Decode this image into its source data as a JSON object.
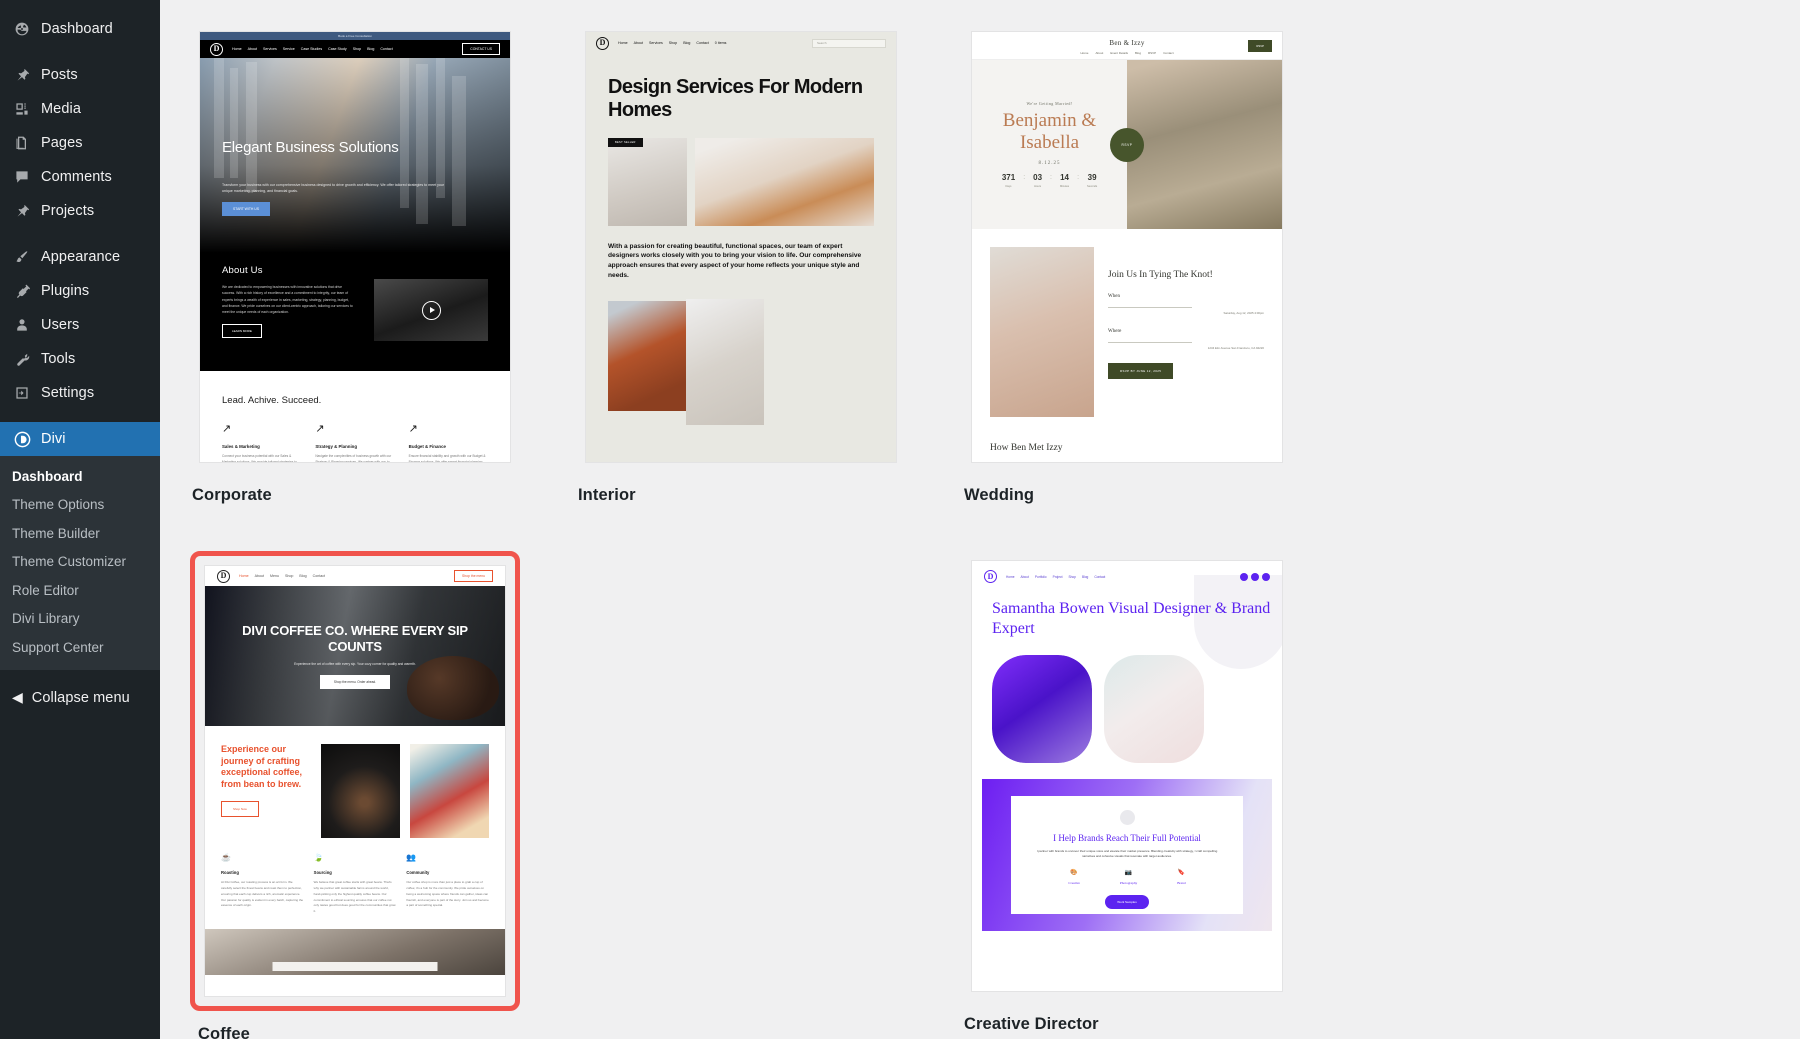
{
  "sidebar": {
    "items": [
      {
        "label": "Dashboard",
        "icon": "dashboard-icon"
      },
      {
        "label": "Posts",
        "icon": "pin-icon"
      },
      {
        "label": "Media",
        "icon": "media-icon"
      },
      {
        "label": "Pages",
        "icon": "pages-icon"
      },
      {
        "label": "Comments",
        "icon": "comment-icon"
      },
      {
        "label": "Projects",
        "icon": "pin-icon"
      },
      {
        "label": "Appearance",
        "icon": "brush-icon"
      },
      {
        "label": "Plugins",
        "icon": "plug-icon"
      },
      {
        "label": "Users",
        "icon": "user-icon"
      },
      {
        "label": "Tools",
        "icon": "wrench-icon"
      },
      {
        "label": "Settings",
        "icon": "settings-icon"
      }
    ],
    "divi": {
      "label": "Divi",
      "icon": "divi-logo-icon"
    },
    "submenu": [
      {
        "label": "Dashboard",
        "current": true
      },
      {
        "label": "Theme Options",
        "current": false
      },
      {
        "label": "Theme Builder",
        "current": false
      },
      {
        "label": "Theme Customizer",
        "current": false
      },
      {
        "label": "Role Editor",
        "current": false
      },
      {
        "label": "Divi Library",
        "current": false
      },
      {
        "label": "Support Center",
        "current": false
      }
    ],
    "collapse": {
      "label": "Collapse menu",
      "icon": "collapse-arrow-icon"
    }
  },
  "layouts": {
    "selected": "Coffee",
    "selection_color": "#f0544c",
    "cards": [
      {
        "name": "Corporate"
      },
      {
        "name": "Interior"
      },
      {
        "name": "Wedding"
      },
      {
        "name": "Coffee"
      },
      {
        "name": "Creative Director"
      }
    ]
  },
  "corporate": {
    "announcement": "Book a Free Consultation",
    "logo": "D",
    "nav": [
      "Home",
      "About",
      "Services",
      "Service",
      "Case Studies",
      "Case Study",
      "Shop",
      "Blog",
      "Contact"
    ],
    "cta": "CONTACT US",
    "hero_title": "Elegant Business Solutions",
    "hero_text": "Transform your business with our comprehensive business designed to drive growth and efficiency. We offer tailored strategies to meet your unique marketing, planning, and financial goals.",
    "hero_button": "START WITH US",
    "about_title": "About Us",
    "about_text": "We are dedicated to empowering businesses with innovative solutions that drive success. With a rich history of excellence and a commitment to integrity, our team of experts brings a wealth of experience in sales, marketing, strategy, planning, budget, and finance. We pride ourselves on our client-centric approach, tailoring our services to meet the unique needs of each organization.",
    "about_button": "LEARN MORE",
    "features_title": "Lead. Achive. Succeed.",
    "features": [
      {
        "title": "Sales & Marketing",
        "text": "Connect your business potential with our Sales & Marketing solutions. We provide tailored strategies to boost your brand visibility, drive customer engagement, and increase sales."
      },
      {
        "title": "Strategy & Planning",
        "text": "Navigate the complexities of business growth with our Strategy & Planning services. We partner with you to develop actionable plans that align with your long-term goals."
      },
      {
        "title": "Budget & Finance",
        "text": "Ensure financial stability and growth with our Budget & Finance solutions. We offer expert financial planning, budgeting, and analysis to help you manage resources efficiently."
      }
    ]
  },
  "interior": {
    "logo": "D",
    "nav": [
      "Home",
      "About",
      "Services",
      "Shop",
      "Blog",
      "Contact",
      "0 items"
    ],
    "search_placeholder": "Search",
    "badge": "BEST SELLER",
    "title": "Design Services For Modern Homes",
    "paragraph": "With a passion for creating beautiful, functional spaces, our team of expert designers works closely with you to bring your vision to life. Our comprehensive approach ensures that every aspect of your home reflects your unique style and needs."
  },
  "wedding": {
    "brand": "Ben & Izzy",
    "nav": [
      "Home",
      "About",
      "Event Details",
      "Blog",
      "RSVP",
      "Contact"
    ],
    "rsvp_top": "RSVP",
    "eyebrow": "We're Getting Married!",
    "names": "Benjamin & Isabella",
    "date": "8.12.25",
    "countdown": [
      {
        "value": "371",
        "label": "Days"
      },
      {
        "value": "03",
        "label": "Hours"
      },
      {
        "value": "14",
        "label": "Minutes"
      },
      {
        "value": "39",
        "label": "Seconds"
      }
    ],
    "section_title": "Join Us In Tying The Knot!",
    "when_label": "When",
    "when_value": "Saturday, Aug 12, 2025\n4:00pm",
    "where_label": "Where",
    "where_value": "1234 Elm Avenue\nSan Francisco, CA 94220",
    "rsvp_button": "RSVP BY JUNE 12, 2025",
    "footer_title": "How Ben Met Izzy"
  },
  "coffee": {
    "logo": "D",
    "nav": [
      "Home",
      "About",
      "Menu",
      "Shop",
      "Blog",
      "Contact"
    ],
    "nav_active": "Home",
    "cta": "Shop the menu",
    "hero_title": "DIVI COFFEE CO. WHERE EVERY SIP COUNTS",
    "hero_sub": "Experience the art of coffee with every sip. Your cozy corner for quality and warmth.",
    "hero_button": "Shop the menu. Order ahead.",
    "section_title": "Experience our journey of crafting exceptional coffee, from bean to brew.",
    "section_button": "Shop Now",
    "features": [
      {
        "icon": "coffee-cup-icon",
        "title": "Roasting",
        "text": "At Divi Coffee, our roasting process is an art form. We carefully select the finest beans and roast them to perfection, ensuring that each cup delivers a rich, aromatic experience. Our passion for quality is evident in every batch, capturing the essence of each origin."
      },
      {
        "icon": "leaf-icon",
        "title": "Sourcing",
        "text": "We believe that great coffee starts with great beans. That's why we partner with sustainable farms around the world, hand-picking only the highest quality coffee beans. Our commitment to ethical sourcing ensures that our coffee not only tastes good but does good for the communities that grow it."
      },
      {
        "icon": "community-icon",
        "title": "Community",
        "text": "Our coffee shop is more than just a place to grab a cup of coffee; it's a hub for the community. We pride ourselves on being a welcoming space where friends can gather, ideas can flourish, and everyone is part of the story. Join us and become a part of something special."
      }
    ]
  },
  "creative_director": {
    "logo": "D",
    "nav": [
      "Home",
      "About",
      "Portfolio",
      "Project",
      "Shop",
      "Blog",
      "Contact"
    ],
    "title": "Samantha Bowen Visual Designer & Brand Expert",
    "panel_title": "I Help Brands Reach Their Full Potential",
    "panel_text": "I partner with brands to uncover their unique voice and elevate their market presence. Blending creativity with strategy, I craft compelling narratives and cohesive visuals that resonate with target audiences.",
    "services": [
      {
        "icon": "palette-icon",
        "label": "Creative"
      },
      {
        "icon": "camera-icon",
        "label": "Photography"
      },
      {
        "icon": "bookmark-icon",
        "label": "Brand"
      }
    ],
    "panel_button": "Work Samples"
  }
}
